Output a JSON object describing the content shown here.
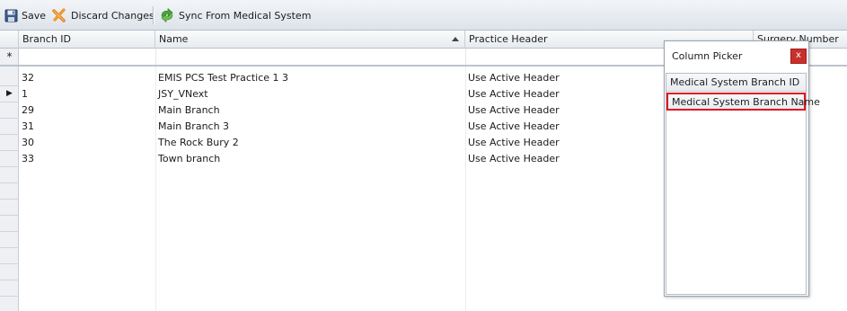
{
  "toolbar": {
    "save_label": "Save",
    "discard_label": "Discard Changes",
    "sync_label": "Sync From Medical System"
  },
  "grid": {
    "columns": [
      "Branch ID",
      "Name",
      "Practice Header",
      "Surgery Number"
    ],
    "sort_column": "Name",
    "sort_direction": "ascending",
    "new_row_marker": "*",
    "current_row_marker": "▶",
    "rows": [
      {
        "branch_id": "32",
        "name": "EMIS PCS Test Practice 1 3",
        "practice_header": "Use Active Header"
      },
      {
        "branch_id": "1",
        "name": "JSY_VNext",
        "practice_header": "Use Active Header"
      },
      {
        "branch_id": "29",
        "name": "Main Branch",
        "practice_header": "Use Active Header"
      },
      {
        "branch_id": "31",
        "name": "Main Branch 3",
        "practice_header": "Use Active Header"
      },
      {
        "branch_id": "30",
        "name": "The Rock Bury 2",
        "practice_header": "Use Active Header"
      },
      {
        "branch_id": "33",
        "name": "Town branch",
        "practice_header": "Use Active Header"
      }
    ]
  },
  "column_picker": {
    "title": "Column Picker",
    "close_label": "x",
    "items": [
      "Medical System Branch ID",
      "Medical System Branch Name"
    ]
  }
}
